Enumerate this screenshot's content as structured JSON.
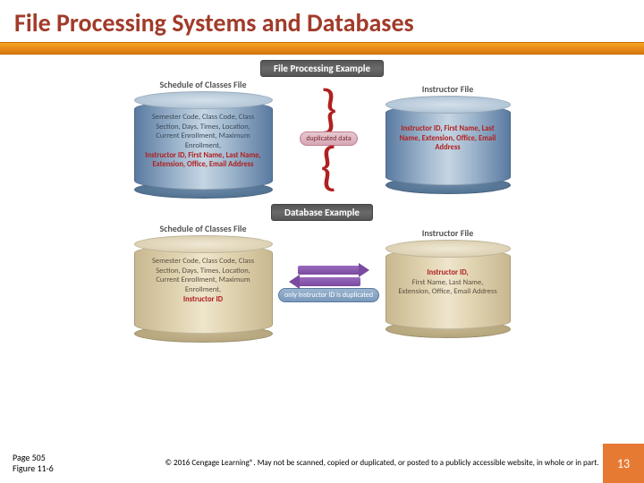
{
  "slide": {
    "title": "File Processing Systems and Databases"
  },
  "fpe": {
    "section_title": "File Processing Example",
    "left_label": "Schedule of Classes File",
    "left_fields": "Semester Code, Class Code, Class Section, Days, Times, Location, Current Enrollment, Maximum Enrollment,",
    "left_highlight": "Instructor ID, First Name, Last Name, Extension, Office, Email Address",
    "center_badge": "duplicated data",
    "right_label": "Instructor File",
    "right_highlight": "Instructor ID, First Name, Last Name, Extension, Office, Email Address"
  },
  "dbe": {
    "section_title": "Database Example",
    "left_label": "Schedule of Classes File",
    "left_fields": "Semester Code, Class Code, Class Section, Days, Times, Location, Current Enrollment, Maximum Enrollment,",
    "left_highlight": "Instructor ID",
    "center_badge": "only Instructor ID is duplicated",
    "right_label": "Instructor File",
    "right_highlight": "Instructor ID,",
    "right_fields": "First Name, Last Name, Extension, Office, Email Address"
  },
  "footer": {
    "page": "Page 505",
    "figure": "Figure 11-6",
    "copyright": "© 2016 Cengage Learning®. May not be scanned, copied or duplicated, or posted to a publicly accessible website, in whole or in part.",
    "slide_number": "13"
  }
}
